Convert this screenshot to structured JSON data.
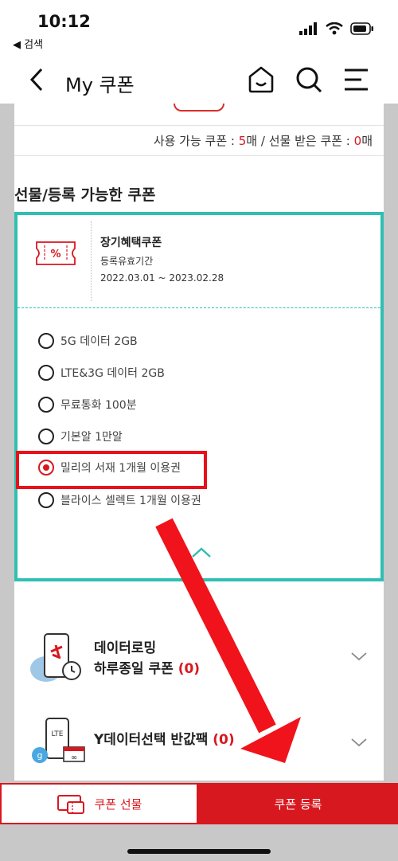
{
  "status_bar": {
    "time": "10:12",
    "back_app": "◀ 검색"
  },
  "header": {
    "title": "My 쿠폰"
  },
  "counts": {
    "available_label": "사용 가능 쿠폰 : ",
    "available_value": "5",
    "available_unit": "매",
    "separator": " / ",
    "gifted_label": "선물 받은 쿠폰 : ",
    "gifted_value": "0",
    "gifted_unit": "매"
  },
  "section_title": "선물/등록 가능한 쿠폰",
  "coupon": {
    "name": "장기혜택쿠폰",
    "validity_label": "등록유효기간",
    "period": "2022.03.01 ~ 2023.02.28",
    "ticket_symbol": "%",
    "options": [
      {
        "label": "5G 데이터 2GB",
        "selected": false
      },
      {
        "label": "LTE&3G 데이터 2GB",
        "selected": false
      },
      {
        "label": "무료통화 100분",
        "selected": false
      },
      {
        "label": "기본알 1만알",
        "selected": false
      },
      {
        "label": "밀리의 서재 1개월 이용권",
        "selected": true
      },
      {
        "label": "블라이스 셀렉트 1개월 이용권",
        "selected": false
      }
    ]
  },
  "accordions": [
    {
      "title_line1": "데이터로밍",
      "title_line2": "하루종일 쿠폰 ",
      "count": "(0)"
    },
    {
      "title_line1": "Y데이터선택 반값팩 ",
      "count": "(0)",
      "icon_text": "LTE"
    }
  ],
  "bottom": {
    "gift_label": "쿠폰 선물",
    "register_label": "쿠폰 등록"
  },
  "colors": {
    "accent": "#d8181f",
    "teal": "#2fbfb2"
  }
}
